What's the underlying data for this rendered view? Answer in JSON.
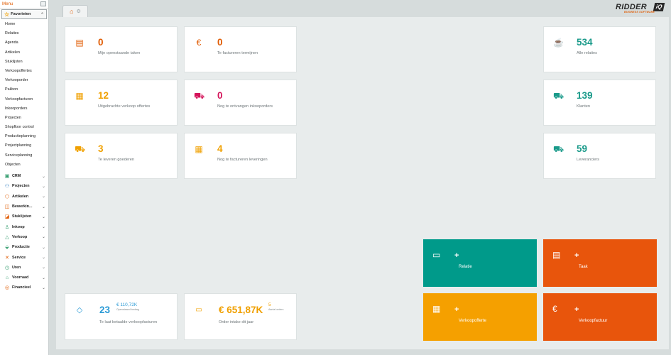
{
  "sidebar": {
    "menu_label": "Menu",
    "favorites_label": "Favorieten",
    "favorites": [
      "Home",
      "Relaties",
      "Agenda",
      "Artikelen",
      "Stuklijsten",
      "Verkoopoffertes",
      "Verkooporder",
      "Pakbon",
      "Verkoopfacturen",
      "Inkooporders",
      "Projecten",
      "Shopfloor control",
      "Productieplanning",
      "Projectplanning",
      "Serviceplanning",
      "Objecten"
    ],
    "groups": [
      {
        "label": "CRM",
        "icon": "crm-icon",
        "color": "#2e9a6a"
      },
      {
        "label": "Projecten",
        "icon": "projects-icon",
        "color": "#2f7dc0"
      },
      {
        "label": "Artikelen",
        "icon": "articles-icon",
        "color": "#e05a00"
      },
      {
        "label": "Bewerkin...",
        "icon": "edit-icon",
        "color": "#e05a00"
      },
      {
        "label": "Stuklijsten",
        "icon": "bom-icon",
        "color": "#e05a00"
      },
      {
        "label": "Inkoop",
        "icon": "purchase-icon",
        "color": "#2e9a6a"
      },
      {
        "label": "Verkoop",
        "icon": "sales-icon",
        "color": "#2e9a6a"
      },
      {
        "label": "Productie",
        "icon": "production-icon",
        "color": "#2e9a6a"
      },
      {
        "label": "Service",
        "icon": "service-icon",
        "color": "#e05a00"
      },
      {
        "label": "Uren",
        "icon": "hours-icon",
        "color": "#2e9a6a"
      },
      {
        "label": "Voorraad",
        "icon": "stock-icon",
        "color": "#2e9a6a"
      },
      {
        "label": "Financieel",
        "icon": "finance-icon",
        "color": "#e05a00"
      }
    ]
  },
  "header": {
    "logo_word": "RIDDER",
    "logo_mark": "iQ",
    "logo_sub": "BUSINESS SOFTWARE"
  },
  "cards": [
    {
      "name": "open-tasks",
      "value": "0",
      "label": "Mijn openstaande taken",
      "color": "#e05a00",
      "icon": "clipboard-icon"
    },
    {
      "name": "invoice-terms",
      "value": "0",
      "label": "Te factureren termijnen",
      "color": "#e05a00",
      "icon": "euro-icon"
    },
    {
      "name": "all-relations",
      "value": "534",
      "label": "Alle relaties",
      "color": "#1a9a8a",
      "icon": "coffee-icon"
    },
    {
      "name": "quotes",
      "value": "12",
      "label": "Uitgebrachte verkoop offertes",
      "color": "#f0a000",
      "icon": "quote-icon"
    },
    {
      "name": "purchase-orders",
      "value": "0",
      "label": "Nog te ontvangen inkooporders",
      "color": "#d4145a",
      "icon": "cart-icon"
    },
    {
      "name": "customers",
      "value": "139",
      "label": "Klanten",
      "color": "#1a9a8a",
      "icon": "cart-icon"
    },
    {
      "name": "deliver-goods",
      "value": "3",
      "label": "Te leveren goederen",
      "color": "#f0a000",
      "icon": "truck-icon"
    },
    {
      "name": "invoice-deliveries",
      "value": "4",
      "label": "Nog te factureren leveringen",
      "color": "#f0a000",
      "icon": "calculator-icon"
    },
    {
      "name": "suppliers",
      "value": "59",
      "label": "Leveranciers",
      "color": "#1a9a8a",
      "icon": "cart-icon"
    }
  ],
  "kpi_overdue": {
    "value": "23",
    "sub_value": "€ 110,72K",
    "sub_label": "Openstaand bedrag",
    "label": "Te laat betaalde verkoopfacturen",
    "color": "#2a9ad6"
  },
  "kpi_intake": {
    "value": "€ 651,87K",
    "sub_value": "5",
    "sub_label": "Aantal orders",
    "label": "Order intake dit jaar",
    "color": "#f0a000"
  },
  "tiles": [
    {
      "name": "new-relation",
      "plus": "+",
      "label": "Relatie",
      "color": "#009a8a",
      "icon": "contact-card-icon"
    },
    {
      "name": "new-task",
      "plus": "+",
      "label": "Taak",
      "color": "#e8550c",
      "icon": "clipboard-icon"
    },
    {
      "name": "new-quote",
      "plus": "+",
      "label": "Verkoopofferte",
      "color": "#f5a000",
      "icon": "quote-icon"
    },
    {
      "name": "new-invoice",
      "plus": "+",
      "label": "Verkoopfactuur",
      "color": "#e8550c",
      "icon": "euro-icon"
    }
  ]
}
